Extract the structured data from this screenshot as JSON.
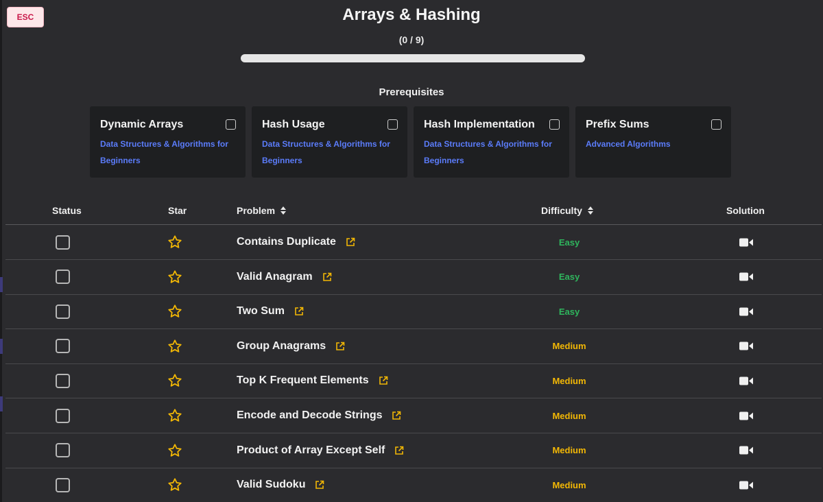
{
  "header": {
    "esc_label": "ESC",
    "title": "Arrays & Hashing",
    "progress_text": "(0 / 9)",
    "progress_fraction": 0
  },
  "prerequisites": {
    "heading": "Prerequisites",
    "items": [
      {
        "title": "Dynamic Arrays",
        "course": "Data Structures & Algorithms for Beginners",
        "checked": false
      },
      {
        "title": "Hash Usage",
        "course": "Data Structures & Algorithms for Beginners",
        "checked": false
      },
      {
        "title": "Hash Implementation",
        "course": "Data Structures & Algorithms for Beginners",
        "checked": false
      },
      {
        "title": "Prefix Sums",
        "course": "Advanced Algorithms",
        "checked": false
      }
    ]
  },
  "table": {
    "columns": {
      "status": "Status",
      "star": "Star",
      "problem": "Problem",
      "difficulty": "Difficulty",
      "solution": "Solution"
    },
    "rows": [
      {
        "problem": "Contains Duplicate",
        "difficulty": "Easy"
      },
      {
        "problem": "Valid Anagram",
        "difficulty": "Easy"
      },
      {
        "problem": "Two Sum",
        "difficulty": "Easy"
      },
      {
        "problem": "Group Anagrams",
        "difficulty": "Medium"
      },
      {
        "problem": "Top K Frequent Elements",
        "difficulty": "Medium"
      },
      {
        "problem": "Encode and Decode Strings",
        "difficulty": "Medium"
      },
      {
        "problem": "Product of Array Except Self",
        "difficulty": "Medium"
      },
      {
        "problem": "Valid Sudoku",
        "difficulty": "Medium"
      }
    ]
  },
  "icons": {
    "star": "star-outline-icon",
    "external": "external-link-icon",
    "solution": "video-camera-icon",
    "sort": "sort-icon"
  },
  "colors": {
    "background": "#2b2b2e",
    "card": "#1e1f21",
    "link_blue": "#5b7cfa",
    "easy": "#2fb55d",
    "medium": "#f2b705",
    "star": "#f2b705",
    "esc_text": "#c9184a"
  }
}
